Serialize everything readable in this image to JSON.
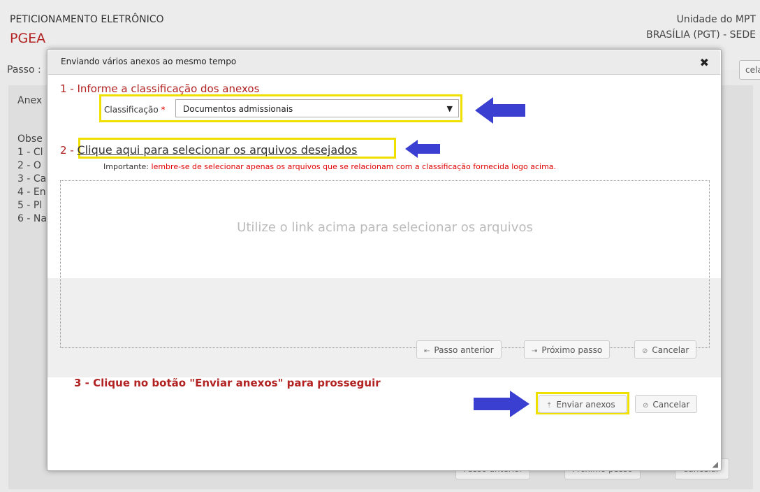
{
  "background": {
    "system_title": "PETICIONAMENTO ELETRÔNICO",
    "app_name": "PGEA",
    "unit_line1": "Unidade do MPT",
    "unit_line2": "BRASÍLIA (PGT) - SEDE",
    "step_label": "Passo :",
    "cancel_top": "celar",
    "anex_label": "Anex",
    "obs_lines": [
      "Obse",
      "1 - Cl",
      "2 - O",
      "3 - Ca",
      "4 - En",
      "5 - Pl",
      "6 - Na"
    ],
    "footer_prev": "Passo anterior",
    "footer_next": "Próximo passo",
    "footer_cancel": "Cancelar"
  },
  "dialog": {
    "title": "Enviando vários anexos ao mesmo tempo",
    "close_symbol": "✖",
    "step1_title": "1 - Informe a classificação dos anexos",
    "classification_label": "Classificação",
    "required_mark": "*",
    "classification_value": "Documentos admissionais",
    "step2_prefix": "2 - ",
    "step2_link": "Clique aqui para selecionar os arquivos desejados",
    "important_label": "Importante:",
    "important_text": "lembre-se de selecionar apenas os arquivos que se relacionam com a classificação fornecida logo acima.",
    "dropzone_hint": "Utilize o link acima para selecionar os arquivos",
    "inner_prev": "Passo anterior",
    "inner_next": "Próximo passo",
    "inner_cancel": "Cancelar",
    "step3_title": "3 - Clique no botão \"Enviar anexos\" para prosseguir",
    "send_button": "Enviar anexos",
    "cancel_button": "Cancelar"
  },
  "colors": {
    "highlight": "#f0e000",
    "annotation_arrow": "#3b3fd1",
    "step_red": "#b22222"
  }
}
